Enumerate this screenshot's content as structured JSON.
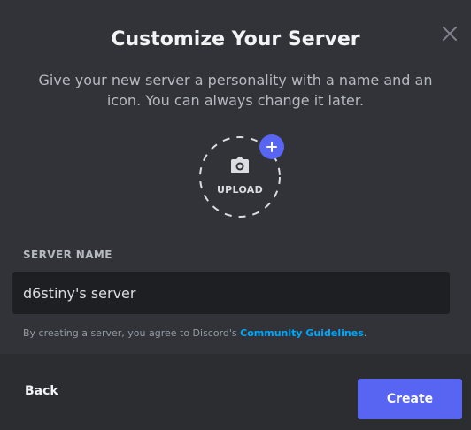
{
  "modal": {
    "title": "Customize Your Server",
    "subtitle": "Give your new server a personality with a name and an icon. You can always change it later."
  },
  "upload": {
    "label": "UPLOAD",
    "icon": "camera-icon",
    "badge_icon": "plus-icon"
  },
  "server_name": {
    "label": "SERVER NAME",
    "value": "d6stiny's server"
  },
  "terms": {
    "prefix": "By creating a server, you agree to Discord's ",
    "link": "Community Guidelines",
    "suffix": "."
  },
  "footer": {
    "back_label": "Back",
    "create_label": "Create"
  },
  "colors": {
    "modal_bg": "#313338",
    "footer_bg": "#2b2d31",
    "input_bg": "#1e1f22",
    "brand": "#5865f2",
    "link": "#00a8fc"
  }
}
